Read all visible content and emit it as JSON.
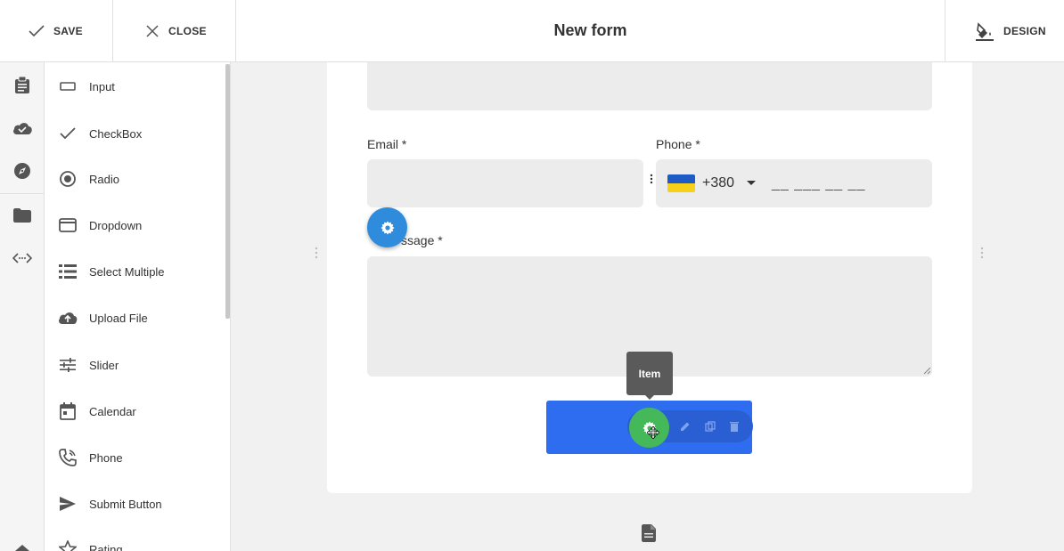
{
  "toolbar": {
    "save_label": "SAVE",
    "close_label": "CLOSE",
    "title": "New form",
    "design_label": "DESIGN"
  },
  "rail": {
    "icons": [
      "clipboard-icon",
      "cloud-check-icon",
      "compass-icon",
      "folder-icon",
      "code-arrows-icon",
      "home-icon"
    ]
  },
  "components": [
    {
      "label": "Input",
      "icon": "input-icon"
    },
    {
      "label": "CheckBox",
      "icon": "check-icon"
    },
    {
      "label": "Radio",
      "icon": "radio-icon"
    },
    {
      "label": "Dropdown",
      "icon": "dropdown-icon"
    },
    {
      "label": "Select Multiple",
      "icon": "list-icon"
    },
    {
      "label": "Upload File",
      "icon": "upload-icon"
    },
    {
      "label": "Slider",
      "icon": "slider-icon"
    },
    {
      "label": "Calendar",
      "icon": "calendar-icon"
    },
    {
      "label": "Phone",
      "icon": "phone-icon"
    },
    {
      "label": "Submit Button",
      "icon": "send-icon"
    },
    {
      "label": "Rating",
      "icon": "star-icon"
    }
  ],
  "form": {
    "email_label": "Email *",
    "phone_label": "Phone *",
    "phone_code": "+380",
    "phone_mask": "__ ___ __ __",
    "message_label_visible": "ssage *",
    "message_label_prefix": "M"
  },
  "tooltip": {
    "text": "Item"
  },
  "colors": {
    "accent_blue": "#2e6cf0",
    "fab_blue": "#2f8bdc",
    "fab_green": "#45b95a"
  }
}
